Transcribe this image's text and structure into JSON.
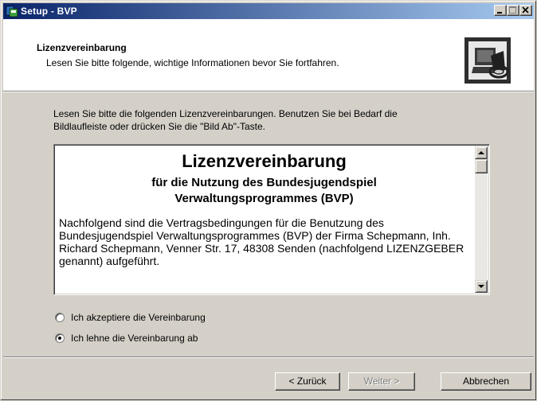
{
  "window": {
    "title": "Setup - BVP"
  },
  "header": {
    "title": "Lizenzvereinbarung",
    "subtitle": "Lesen Sie bitte folgende, wichtige Informationen bevor Sie fortfahren."
  },
  "intro": {
    "line1": "Lesen Sie bitte die folgenden Lizenzvereinbarungen. Benutzen Sie bei Bedarf die",
    "line2": "Bildlaufleiste oder drücken Sie die \"Bild Ab\"-Taste."
  },
  "license": {
    "heading": "Lizenzvereinbarung",
    "sub1": "für die Nutzung des Bundesjugendspiel",
    "sub2": "Verwaltungsprogrammes (BVP)",
    "body": "Nachfolgend sind die Vertragsbedingungen für die Benutzung des Bundesjugendspiel Verwaltungsprogrammes (BVP) der Firma Schepmann, Inh. Richard Schepmann, Venner Str. 17, 48308 Senden (nachfolgend LIZENZGEBER genannt) aufgeführt."
  },
  "options": {
    "accept": "Ich akzeptiere die Vereinbarung",
    "decline": "Ich lehne die Vereinbarung ab",
    "selected": "decline"
  },
  "buttons": {
    "back": "< Zurück",
    "next": "Weiter >",
    "cancel": "Abbrechen"
  },
  "icons": {
    "app": "setup-app-icon",
    "wizard": "computer-install-icon"
  }
}
